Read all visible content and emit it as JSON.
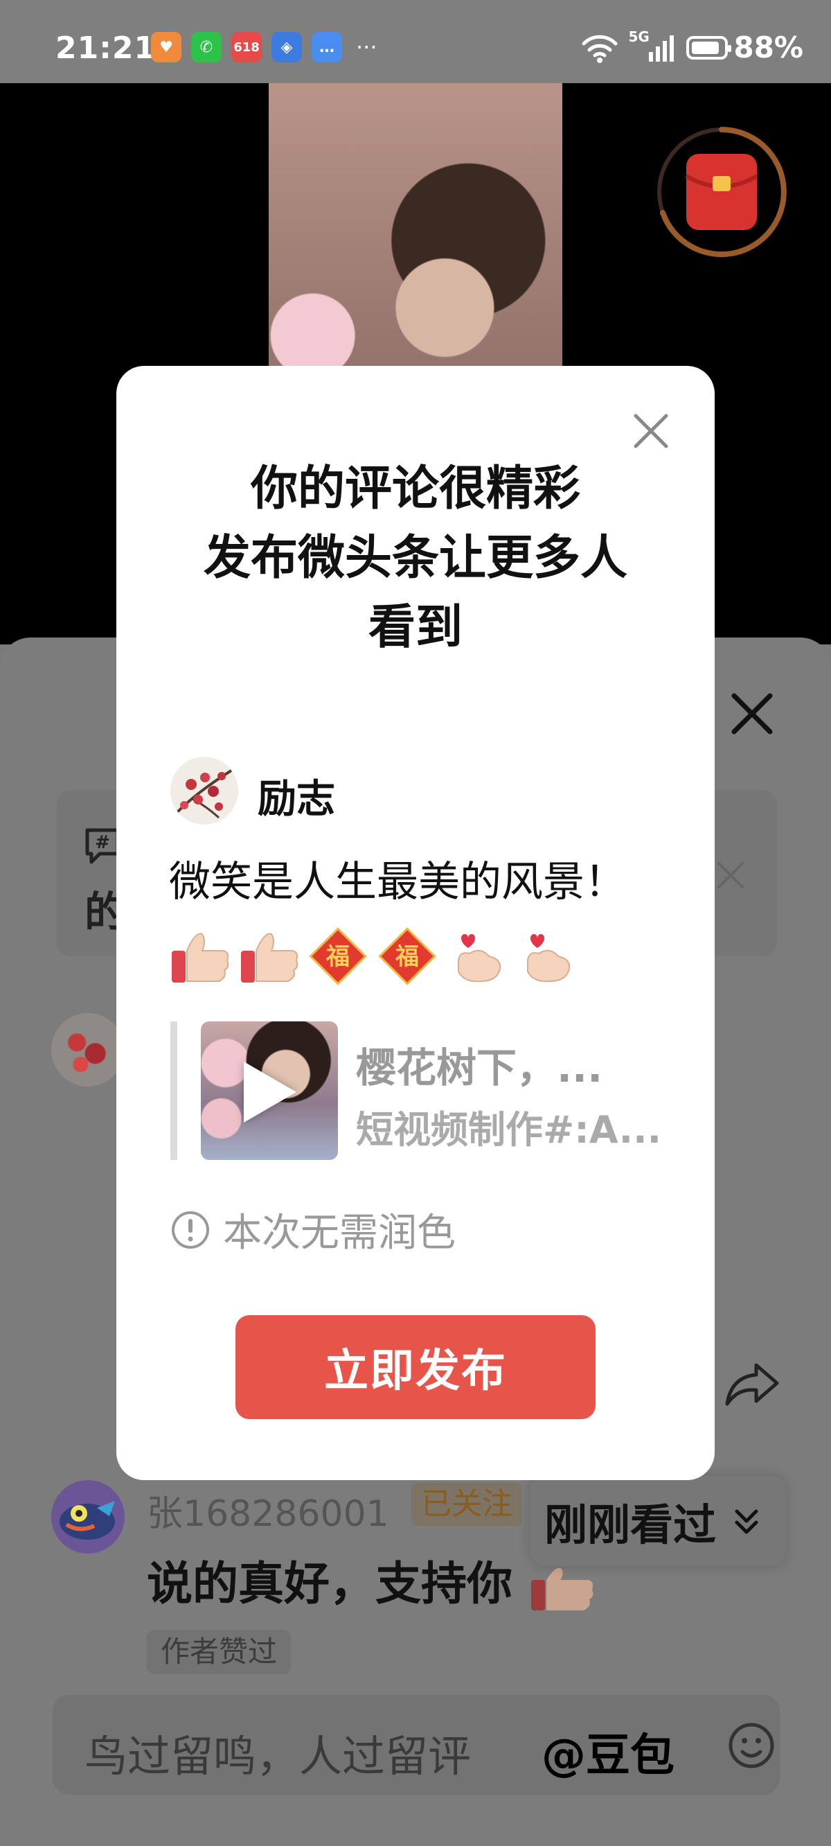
{
  "status_bar": {
    "time": "21:21",
    "battery": "88%",
    "battery_level": 0.88,
    "network": "5G",
    "apps": [
      {
        "name": "heart-app-icon",
        "label": "♥",
        "color": "#f08a3c"
      },
      {
        "name": "wechat-icon",
        "label": "✆",
        "color": "#2dc24a"
      },
      {
        "name": "shopping-618-icon",
        "label": "618",
        "color": "#e84a4a"
      },
      {
        "name": "wallet-app-icon",
        "label": "◈",
        "color": "#3d7be0"
      },
      {
        "name": "message-app-icon",
        "label": "…",
        "color": "#4a8df0"
      }
    ],
    "more_dots": "···"
  },
  "sheet": {
    "topic_text": "的",
    "comment": {
      "username": "张168286001",
      "follow_badge": "已关注",
      "text": "说的真好，支持你",
      "liked_badge": "作者赞过"
    },
    "recently_viewed": "刚刚看过",
    "input": {
      "placeholder": "鸟过留鸣，人过留评",
      "mention": "@豆包"
    }
  },
  "popup": {
    "title": "你的评论很精彩\n发布微头条让更多人\n看到",
    "author_name": "励志",
    "post_text": "微笑是人生最美的风景！",
    "emojis": [
      "thumbs-up",
      "thumbs-up",
      "fu",
      "fu",
      "finger-heart",
      "finger-heart"
    ],
    "quote_title": "樱花树下，...",
    "quote_subtitle": "短视频制作#:A...",
    "polish_note": "本次无需润色",
    "publish_button": "立即发布"
  },
  "colors": {
    "publish_button": "#e7554a",
    "follow_badge_text": "#8a5d1d",
    "redpacket": "#d8342f"
  }
}
